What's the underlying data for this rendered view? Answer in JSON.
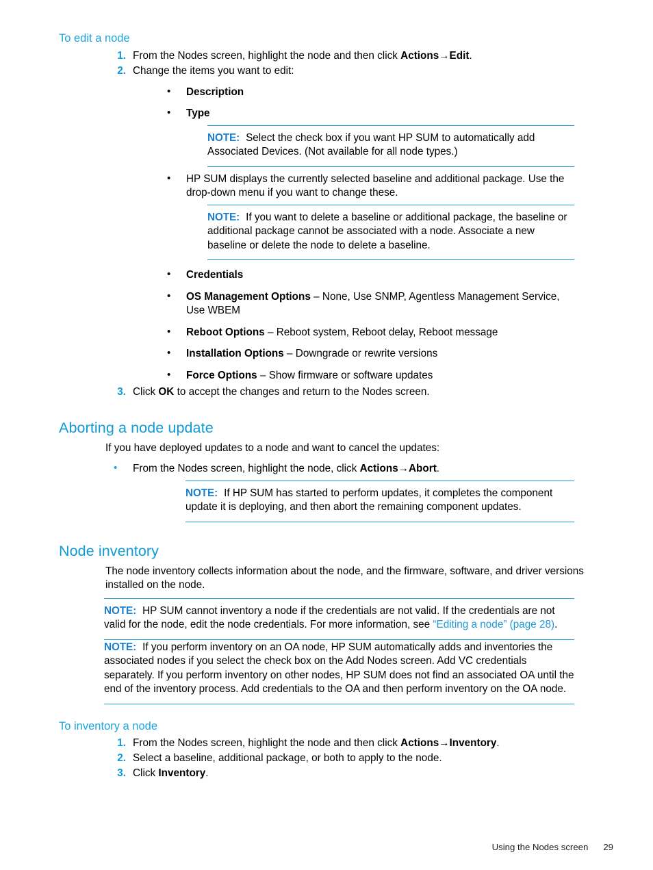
{
  "page": {
    "footer_title": "Using the Nodes screen",
    "footer_page": "29",
    "accent_blue": "#0f9ad8",
    "note_blue": "#1b7fd0",
    "rule_blue": "#1b9ad6"
  },
  "sections": {
    "edit_node": {
      "heading": "To edit a node",
      "steps": [
        {
          "num": "1.",
          "pre": "From the Nodes screen, highlight the node and then click ",
          "bold1": "Actions",
          "arrow": "→",
          "bold2": "Edit",
          "post": "."
        },
        {
          "num": "2.",
          "pre": "Change the items you want to edit:",
          "bold1": "",
          "arrow": "",
          "bold2": "",
          "post": ""
        },
        {
          "num": "3.",
          "pre": "Click ",
          "bold1": "OK",
          "arrow": "",
          "bold2": "",
          "post": " to accept the changes and return to the Nodes screen."
        }
      ],
      "bullets": [
        {
          "bold": "Description",
          "rest": ""
        },
        {
          "bold": "Type",
          "rest": ""
        }
      ],
      "note_type": {
        "label": "NOTE:",
        "text": "Select the check box if you want HP SUM to automatically add Associated Devices. (Not available for all node types.)"
      },
      "bullet_baseline": {
        "bold": "",
        "rest": "HP SUM displays the currently selected baseline and additional package. Use the drop-down menu if you want to change these."
      },
      "note_baseline": {
        "label": "NOTE:",
        "text": "If you want to delete a baseline or additional package, the baseline or additional package cannot be associated with a node. Associate a new baseline or delete the node to delete a baseline."
      },
      "options_bullets": [
        {
          "bold": "Credentials",
          "rest": ""
        },
        {
          "bold": "OS Management Options",
          "rest": " – None, Use SNMP, Agentless Management Service, Use WBEM"
        },
        {
          "bold": "Reboot Options",
          "rest": " – Reboot system, Reboot delay, Reboot message"
        },
        {
          "bold": "Installation Options",
          "rest": " – Downgrade or rewrite versions"
        },
        {
          "bold": "Force Options",
          "rest": " – Show firmware or software updates"
        }
      ]
    },
    "aborting": {
      "heading": "Aborting a node update",
      "intro": "If you have deployed updates to a node and want to cancel the updates:",
      "bullet": {
        "pre": "From the Nodes screen, highlight the node, click ",
        "bold1": "Actions",
        "arrow": "→",
        "bold2": "Abort",
        "post": "."
      },
      "note": {
        "label": "NOTE:",
        "text": "If HP SUM has started to perform updates, it completes the component update it is deploying, and then abort the remaining component updates."
      }
    },
    "node_inventory": {
      "heading": "Node inventory",
      "intro": "The node inventory collects information about the node, and the firmware, software, and driver versions installed on the node.",
      "note_credentials": {
        "label": "NOTE:",
        "text_before": "HP SUM cannot inventory a node if the credentials are not valid. If the credentials are not valid for the node, edit the node credentials. For more information, see ",
        "link_text": "“Editing a node” (page 28)",
        "text_after": "."
      },
      "note_oa": {
        "label": "NOTE:",
        "text": "If you perform inventory on an OA node, HP SUM automatically adds and inventories the associated nodes if you select the check box on the Add Nodes screen. Add VC credentials separately. If you perform inventory on other nodes, HP SUM does not find an associated OA until the end of the inventory process. Add credentials to the OA and then perform inventory on the OA node."
      }
    },
    "inventory_node": {
      "heading": "To inventory a node",
      "steps": [
        {
          "num": "1.",
          "pre": "From the Nodes screen, highlight the node and then click ",
          "bold1": "Actions",
          "arrow": "→",
          "bold2": "Inventory",
          "post": "."
        },
        {
          "num": "2.",
          "pre": "Select a baseline, additional package, or both to apply to the node.",
          "bold1": "",
          "arrow": "",
          "bold2": "",
          "post": ""
        },
        {
          "num": "3.",
          "pre": "Click ",
          "bold1": "Inventory",
          "arrow": "",
          "bold2": "",
          "post": "."
        }
      ]
    }
  }
}
